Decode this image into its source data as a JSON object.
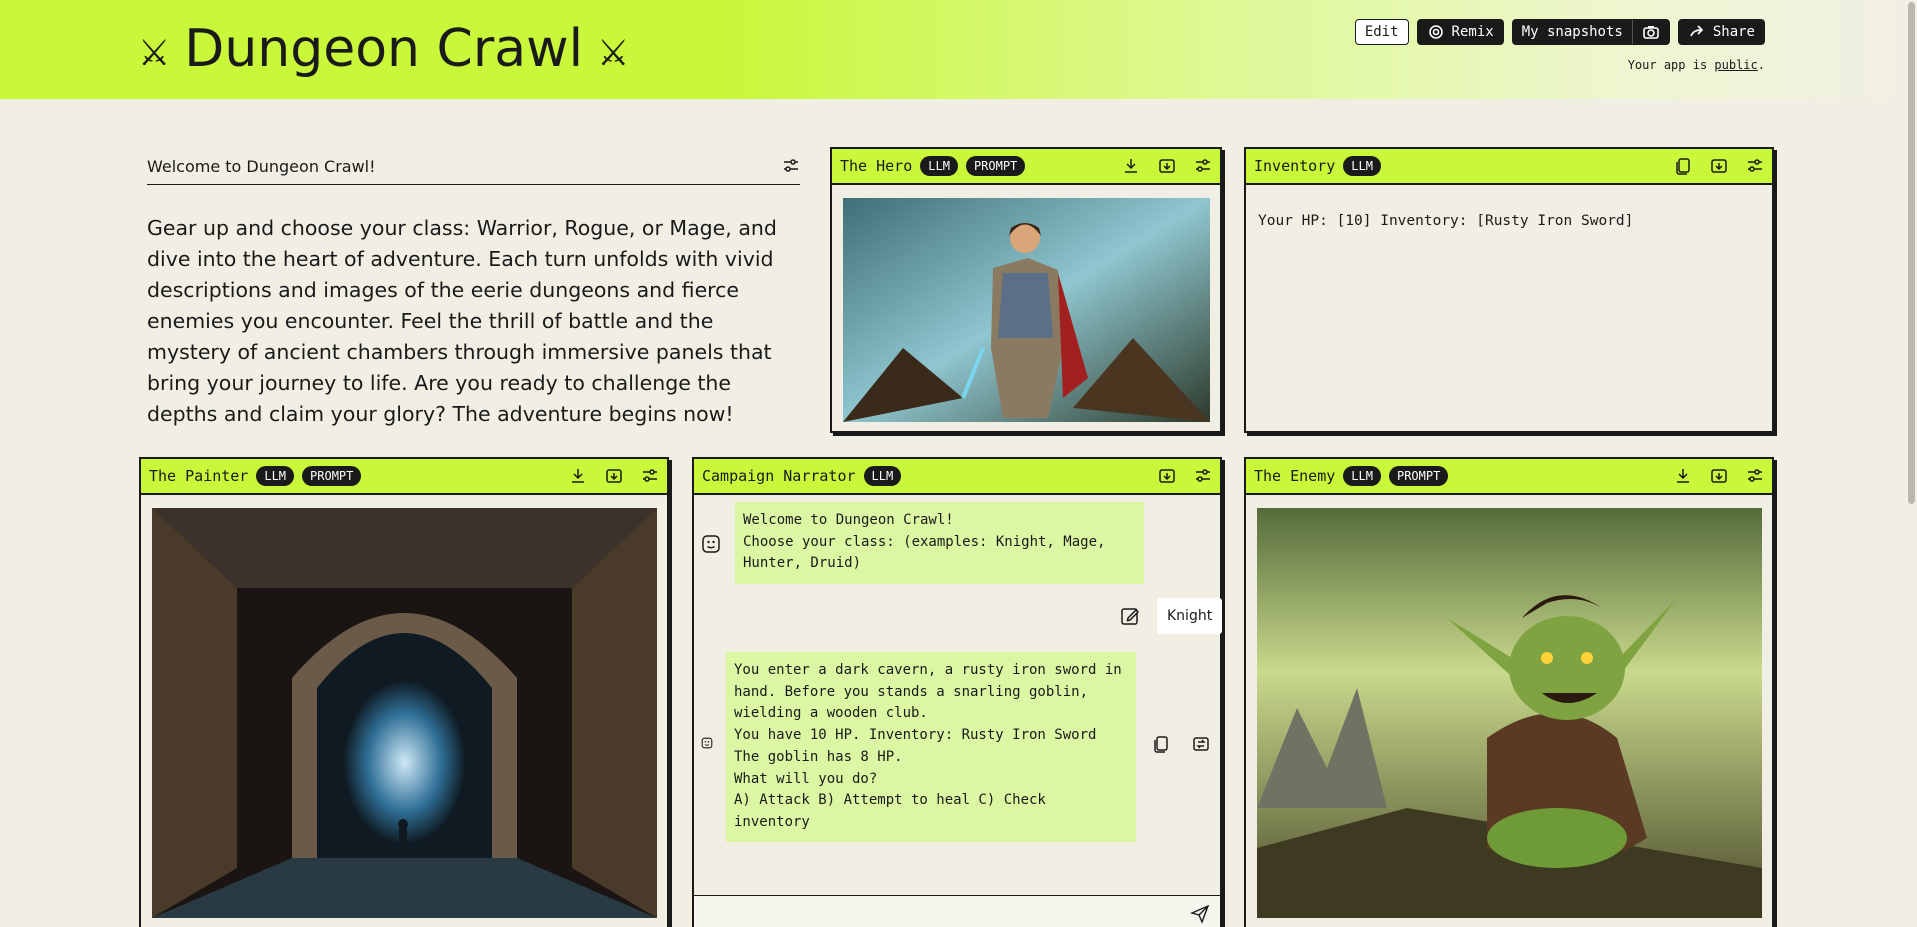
{
  "header": {
    "title": "Dungeon Crawl",
    "swords": "⚔",
    "edit_label": "Edit",
    "remix_label": "Remix",
    "snapshots_label": "My snapshots",
    "share_label": "Share",
    "note_prefix": "Your app is ",
    "note_link": "public",
    "note_suffix": "."
  },
  "welcome": {
    "heading": "Welcome to Dungeon Crawl!",
    "body": "Gear up and choose your class: Warrior, Rogue, or Mage, and dive into the heart of adventure. Each turn unfolds with vivid descriptions and images of the eerie dungeons and fierce enemies you encounter. Feel the thrill of battle and the mystery of ancient chambers through immersive panels that bring your journey to life. Are you ready to challenge the depths and claim your glory? The adventure begins now!"
  },
  "panels": {
    "hero": {
      "title": "The Hero",
      "badges": [
        "LLM",
        "PROMPT"
      ]
    },
    "inventory": {
      "title": "Inventory",
      "badges": [
        "LLM"
      ],
      "text": "Your HP: [10] Inventory: [Rusty Iron Sword]"
    },
    "painter": {
      "title": "The Painter",
      "badges": [
        "LLM",
        "PROMPT"
      ]
    },
    "narrator": {
      "title": "Campaign Narrator",
      "badges": [
        "LLM"
      ],
      "msg1": "Welcome to Dungeon Crawl!\nChoose your class: (examples: Knight, Mage, Hunter, Druid)",
      "user_reply": "Knight",
      "msg2": "You enter a dark cavern, a rusty iron sword in hand. Before you stands a snarling goblin, wielding a wooden club.\nYou have 10 HP. Inventory: Rusty Iron Sword\nThe goblin has 8 HP.\nWhat will you do?\nA) Attack B) Attempt to heal C) Check inventory"
    },
    "enemy": {
      "title": "The Enemy",
      "badges": [
        "LLM",
        "PROMPT"
      ]
    }
  },
  "colors": {
    "accent": "#c9f73a",
    "bg": "#f1efe4",
    "dark": "#1a1a1a",
    "bubble": "#dcf7a3"
  }
}
